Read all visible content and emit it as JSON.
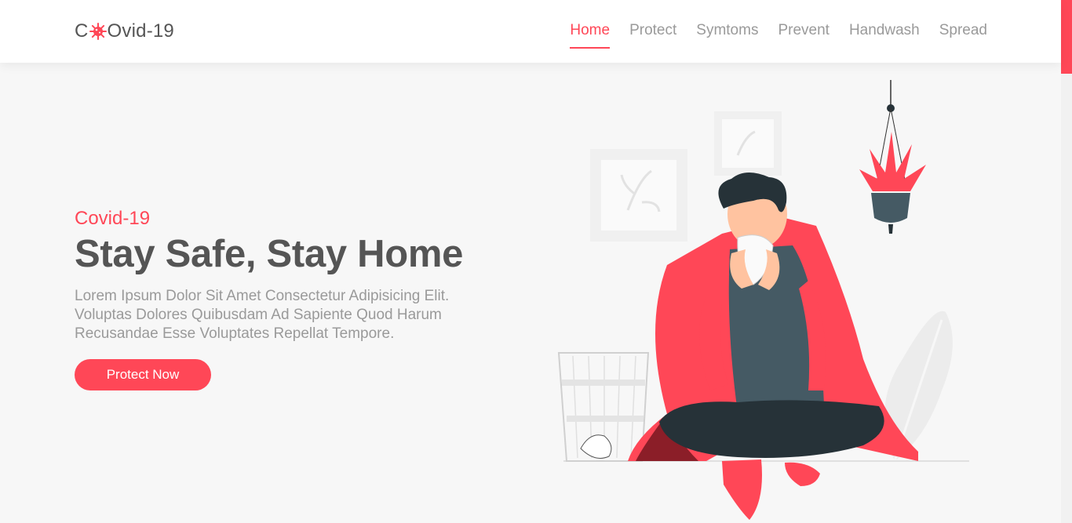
{
  "brand": {
    "prefix": "C",
    "suffix": "Ovid-19"
  },
  "nav": {
    "items": [
      {
        "label": "Home",
        "active": true
      },
      {
        "label": "Protect",
        "active": false
      },
      {
        "label": "Symtoms",
        "active": false
      },
      {
        "label": "Prevent",
        "active": false
      },
      {
        "label": "Handwash",
        "active": false
      },
      {
        "label": "Spread",
        "active": false
      }
    ]
  },
  "hero": {
    "eyebrow": "Covid-19",
    "title": "Stay Safe, Stay Home",
    "description": "Lorem Ipsum Dolor Sit Amet Consectetur Adipisicing Elit. Voluptas Dolores Quibusdam Ad Sapiente Quod Harum Recusandae Esse Voluptates Repellat Tempore.",
    "cta_label": "Protect Now"
  },
  "colors": {
    "accent": "#ff4757",
    "text": "#555555",
    "muted": "#9a9a9a",
    "background": "#f7f7f7"
  },
  "icons": {
    "logo_icon": "virus-icon"
  }
}
